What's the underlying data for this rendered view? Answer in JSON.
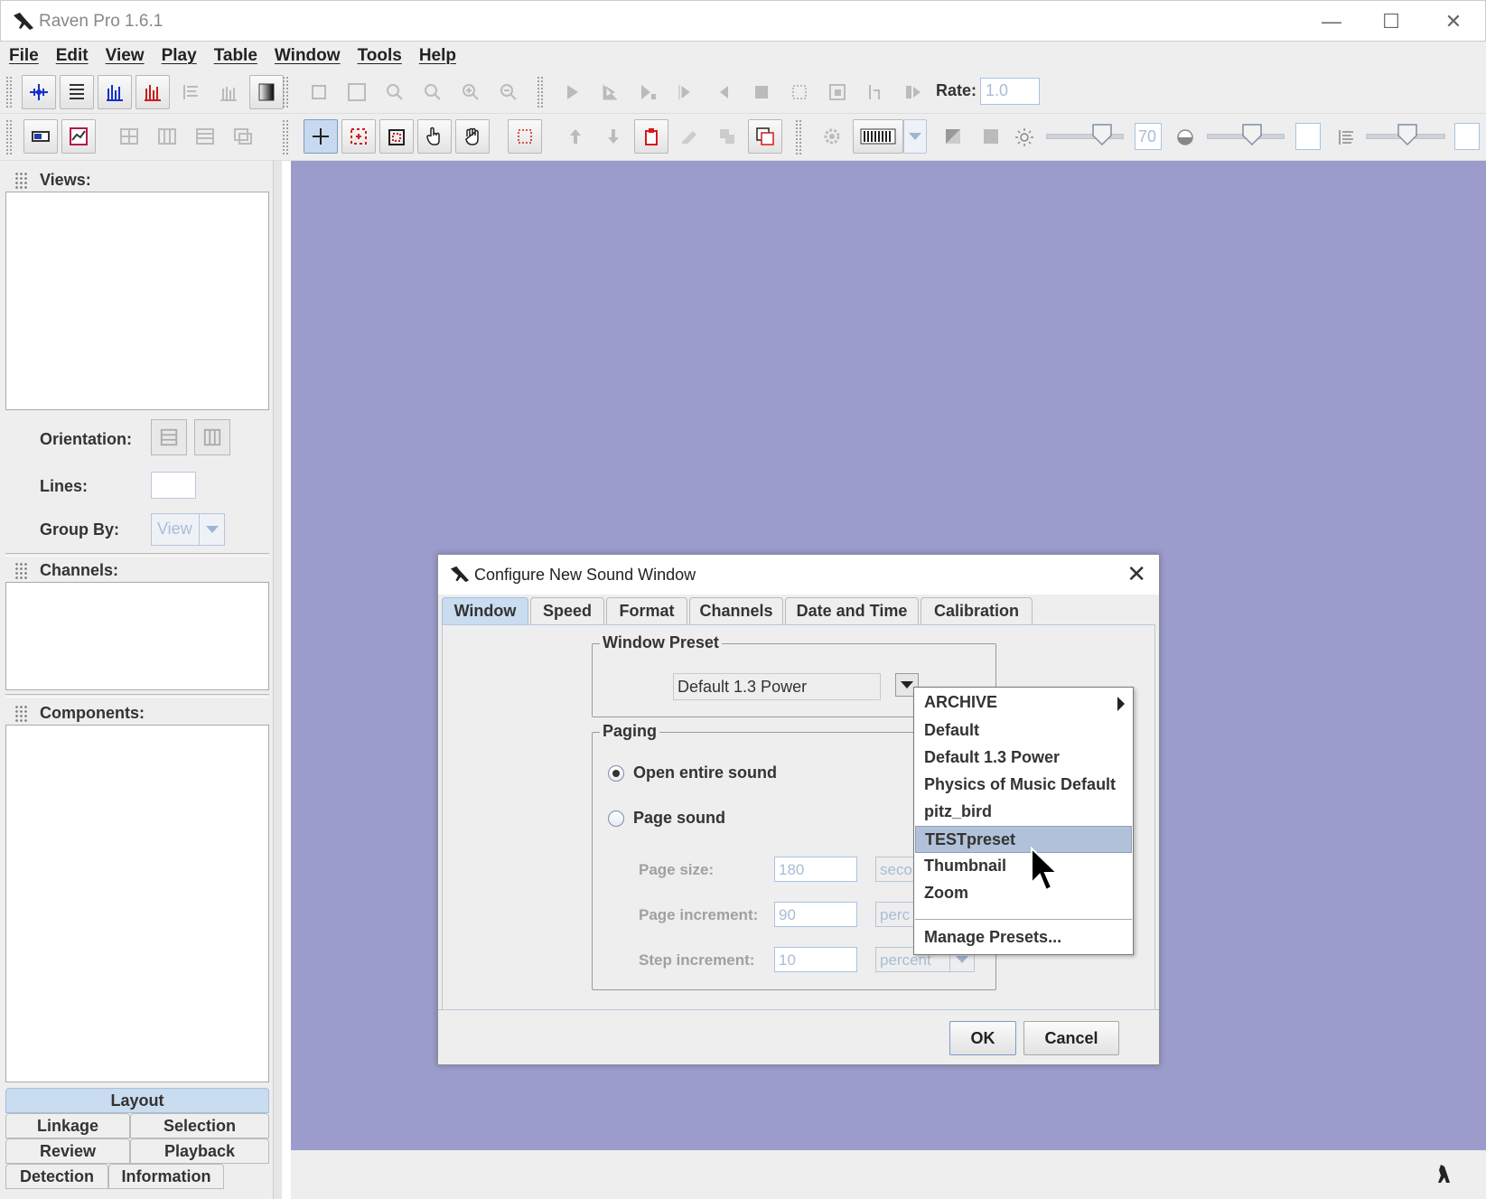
{
  "app": {
    "title": "Raven Pro 1.6.1"
  },
  "window_controls": {
    "minimize": "—",
    "maximize": "☐",
    "close": "✕"
  },
  "menu": [
    "File",
    "Edit",
    "View",
    "Play",
    "Table",
    "Window",
    "Tools",
    "Help"
  ],
  "toolbar": {
    "rate_label": "Rate:",
    "rate_value": "1.0",
    "brightness_value": "70"
  },
  "side_panel": {
    "views_header": "Views:",
    "orientation_label": "Orientation:",
    "lines_label": "Lines:",
    "group_by_label": "Group By:",
    "group_by_value": "View",
    "channels_header": "Channels:",
    "components_header": "Components:",
    "tabs": [
      "Layout",
      "Linkage",
      "Selection",
      "Review",
      "Playback",
      "Detection",
      "Information"
    ]
  },
  "dialog": {
    "title": "Configure New Sound Window",
    "close": "✕",
    "tabs": [
      "Window",
      "Speed",
      "Format",
      "Channels",
      "Date and Time",
      "Calibration"
    ],
    "window_preset_group": "Window Preset",
    "preset_value": "Default 1.3 Power",
    "paging_group": "Paging",
    "open_entire_sound": "Open entire sound",
    "page_sound": "Page sound",
    "page_size_label": "Page size:",
    "page_size_value": "180",
    "page_size_unit": "seco",
    "page_increment_label": "Page increment:",
    "page_increment_value": "90",
    "page_increment_unit": "perc",
    "step_increment_label": "Step increment:",
    "step_increment_value": "10",
    "step_increment_unit": "percent",
    "ok": "OK",
    "cancel": "Cancel"
  },
  "preset_menu": {
    "items": [
      "ARCHIVE",
      "Default",
      "Default 1.3 Power",
      "Physics of Music Default",
      "pitz_bird",
      "TESTpreset",
      "Thumbnail",
      "Zoom"
    ],
    "highlighted": "TESTpreset",
    "manage": "Manage Presets..."
  }
}
